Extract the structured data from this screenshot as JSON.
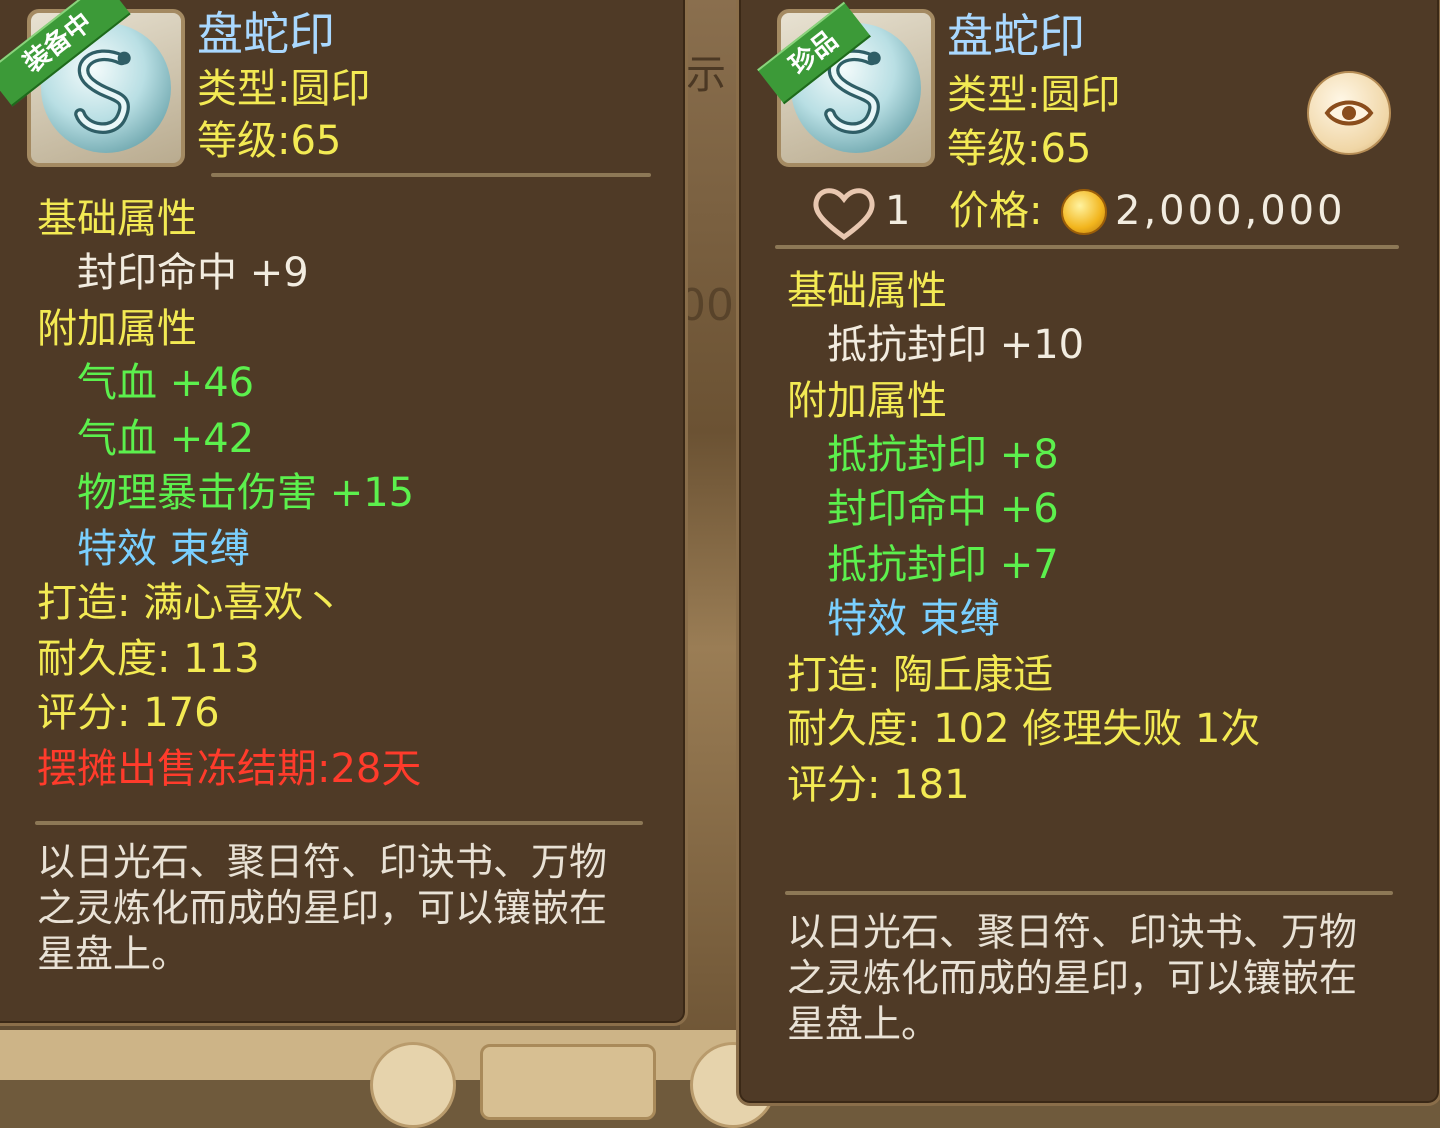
{
  "left": {
    "ribbon": "装备中",
    "name": "盘蛇印",
    "type": "类型:圆印",
    "level": "等级:65",
    "base_header": "基础属性",
    "base_attrs": [
      "封印命中  +9"
    ],
    "extra_header": "附加属性",
    "extra_attrs": [
      "气血  +46",
      "气血  +42",
      "物理暴击伤害  +15"
    ],
    "special": "特效  束缚",
    "forge": "打造:  满心喜欢丶",
    "durability": "耐久度:  113",
    "score": "评分:  176",
    "freeze": "摆摊出售冻结期:28天",
    "description": "以日光石、聚日符、印诀书、万物之灵炼化而成的星印，可以镶嵌在星盘上。"
  },
  "right": {
    "ribbon": "珍品",
    "name": "盘蛇印",
    "type": "类型:圆印",
    "level": "等级:65",
    "likes": "1",
    "price_label": "价格:",
    "price": "2,000,000",
    "base_header": "基础属性",
    "base_attrs": [
      "抵抗封印  +10"
    ],
    "extra_header": "附加属性",
    "extra_attrs": [
      "抵抗封印  +8",
      "封印命中  +6",
      "抵抗封印  +7"
    ],
    "special": "特效  束缚",
    "forge": "打造:  陶丘康适",
    "durability": "耐久度:  102  修理失败  1次",
    "score": "评分:  181",
    "description": "以日光石、聚日符、印诀书、万物之灵炼化而成的星印，可以镶嵌在星盘上。"
  },
  "icons": {
    "item": "snake-seal-icon",
    "eye": "eye-icon",
    "heart": "heart-icon",
    "coin": "gold-coin-icon"
  },
  "colors": {
    "title": "#a9d8ff",
    "header": "#f3ea53",
    "attr_extra": "#5cf04d",
    "special": "#7ad0ff",
    "freeze": "#ff3b2b"
  }
}
